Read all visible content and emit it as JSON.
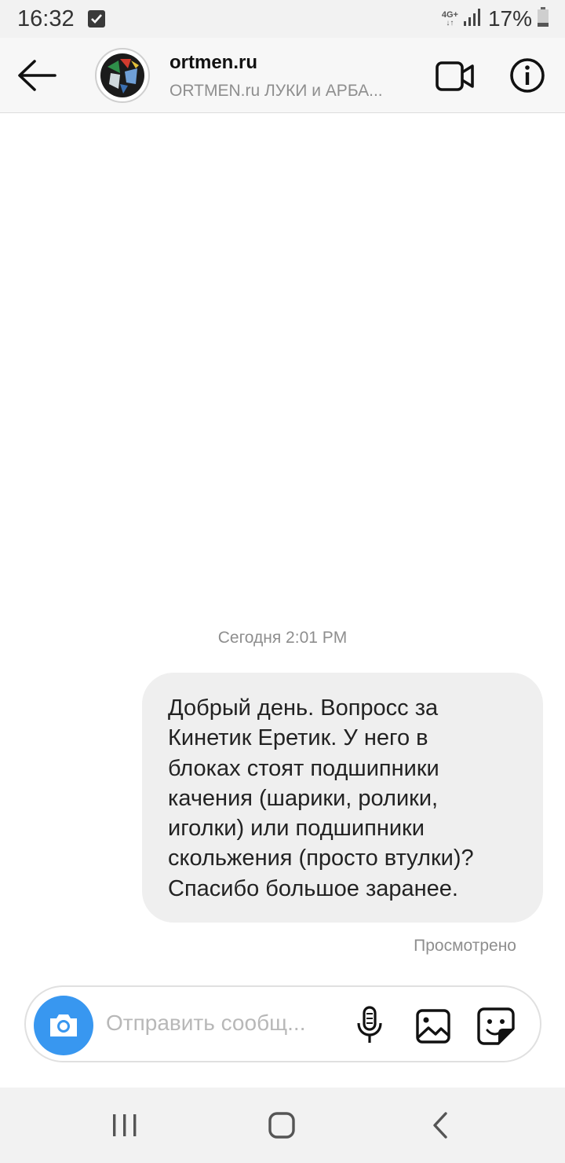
{
  "status_bar": {
    "time": "16:32",
    "network": "4G+",
    "battery": "17%"
  },
  "header": {
    "title": "ortmen.ru",
    "subtitle": "ORTMEN.ru ЛУКИ и АРБА..."
  },
  "messages": {
    "timestamp": "Сегодня 2:01 PM",
    "outgoing_text": "Добрый день. Вопросс за\nКинетик Еретик. У него в\nблоках стоят подшипники\nкачения (шарики, ролики,\nиголки) или подшипники\nскольжения (просто втулки)?\nСпасибо большое заранее.",
    "seen_label": "Просмотрено"
  },
  "composer": {
    "placeholder": "Отправить сообщ..."
  },
  "icons": {
    "back": "arrow-left-icon",
    "video": "video-camera-icon",
    "info": "info-icon",
    "camera": "camera-icon",
    "mic": "microphone-icon",
    "gallery": "image-icon",
    "sticker": "sticker-icon"
  },
  "colors": {
    "accent": "#3897f0",
    "bubble": "#efefef",
    "muted_text": "#8e8e8e"
  }
}
